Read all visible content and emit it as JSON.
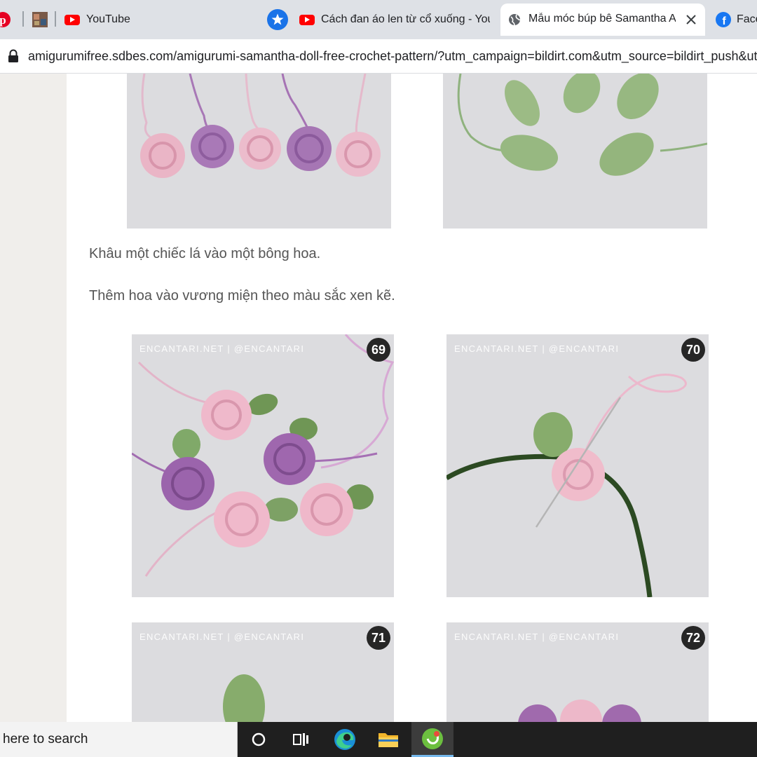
{
  "browser": {
    "tabs": [
      {
        "label": "YouTube",
        "icon": "youtube-icon"
      },
      {
        "label": "Cách đan áo len từ cổ xuống - You",
        "icon": "youtube-icon"
      },
      {
        "label": "Mẫu móc búp bê Samantha A",
        "icon": "globe-icon",
        "active": true
      },
      {
        "label": "Face",
        "icon": "facebook-icon"
      }
    ],
    "url": "amigurumifree.sdbes.com/amigurumi-samantha-doll-free-crochet-pattern/?utm_campaign=bildirt.com&utm_source=bildirt_push&utm"
  },
  "content": {
    "paragraphs": [
      "Khâu một chiếc lá vào một bông hoa.",
      "Thêm hoa vào vương miện theo màu sắc xen kẽ."
    ],
    "watermark": "ENCANTARI.NET | @ENCANTARI",
    "steps": [
      "69",
      "70",
      "71",
      "72"
    ]
  },
  "taskbar": {
    "search_placeholder": "here to search"
  },
  "colors": {
    "tab_bar": "#dee1e6",
    "youtube_red": "#ff0000",
    "facebook_blue": "#1877f2",
    "pinterest_red": "#e60023",
    "taskbar": "#1f1f1f",
    "photo_background": "#dcdcdf"
  }
}
